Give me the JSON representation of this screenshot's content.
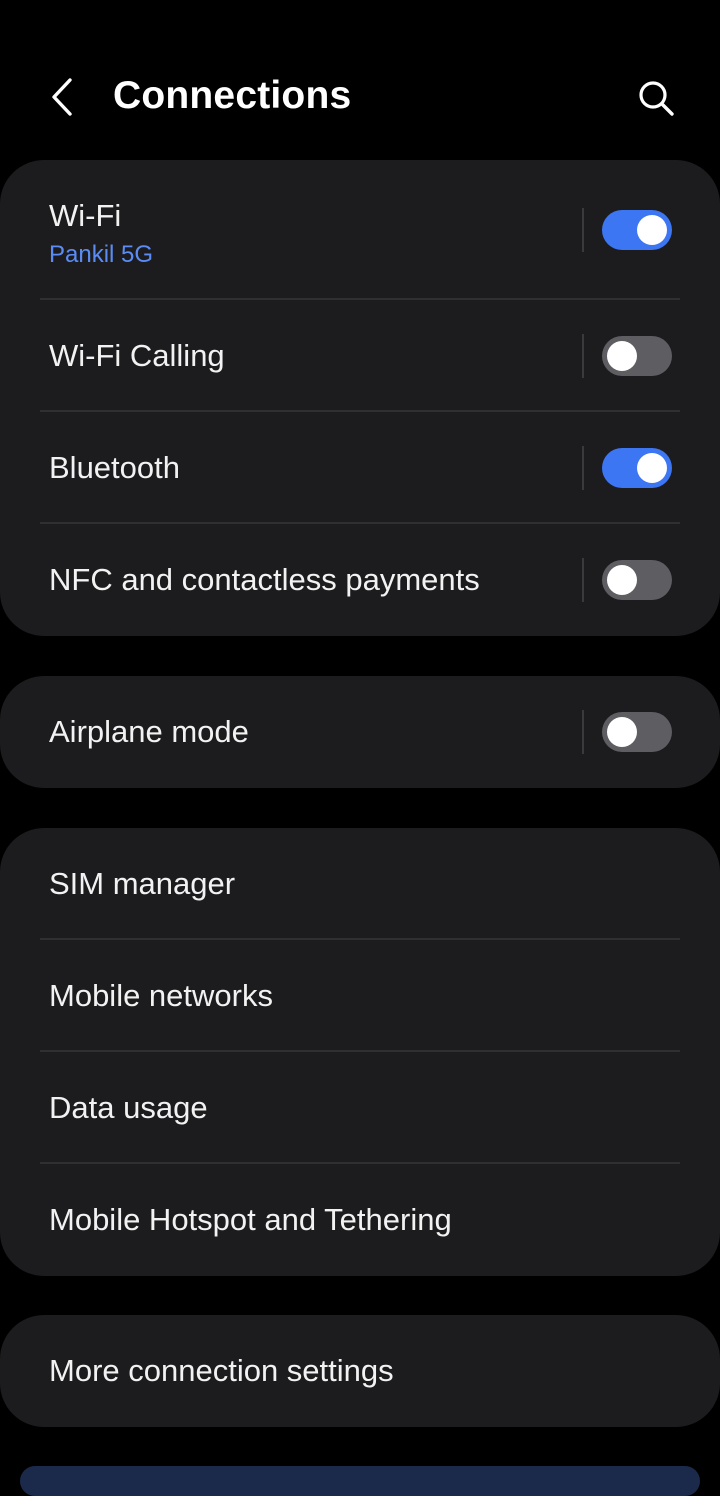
{
  "header": {
    "title": "Connections",
    "back_icon": "chevron-left-icon",
    "search_icon": "search-icon"
  },
  "colors": {
    "background": "#000000",
    "card": "#1c1c1e",
    "accent": "#3d76f2",
    "subtext": "#5b8cf5",
    "toggle_off": "#5e5e62"
  },
  "group1": {
    "wifi": {
      "label": "Wi-Fi",
      "network": "Pankil 5G",
      "enabled": true
    },
    "wifi_calling": {
      "label": "Wi-Fi Calling",
      "enabled": false
    },
    "bluetooth": {
      "label": "Bluetooth",
      "enabled": true
    },
    "nfc": {
      "label": "NFC and contactless payments",
      "enabled": false
    }
  },
  "group2": {
    "airplane": {
      "label": "Airplane mode",
      "enabled": false
    }
  },
  "group3": {
    "sim_manager": {
      "label": "SIM manager"
    },
    "mobile_networks": {
      "label": "Mobile networks"
    },
    "data_usage": {
      "label": "Data usage"
    },
    "hotspot": {
      "label": "Mobile Hotspot and Tethering"
    }
  },
  "group4": {
    "more": {
      "label": "More connection settings"
    }
  }
}
